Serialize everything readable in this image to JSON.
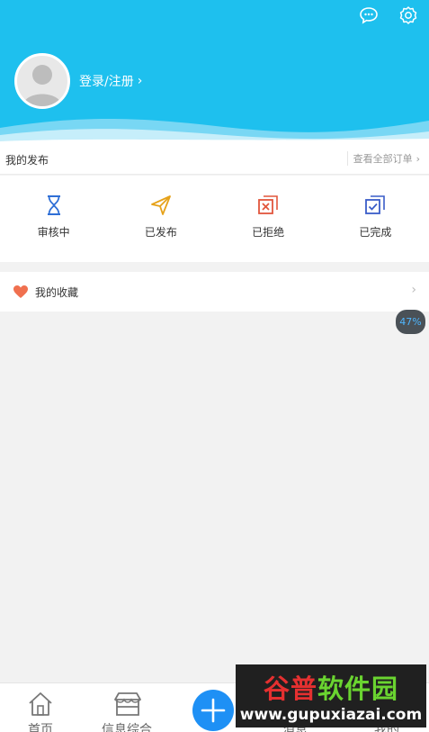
{
  "header": {
    "login_label": "登录/注册",
    "login_chevron": "›",
    "icons": [
      "message-icon",
      "gear-icon"
    ]
  },
  "publish": {
    "title": "我的发布",
    "view_all": "查看全部订单",
    "view_all_chevron": "›",
    "items": [
      {
        "label": "审核中",
        "icon": "hourglass-icon",
        "color": "#2f6fd6"
      },
      {
        "label": "已发布",
        "icon": "paper-plane-icon",
        "color": "#e6a21a"
      },
      {
        "label": "已拒绝",
        "icon": "rejected-icon",
        "color": "#e2563c"
      },
      {
        "label": "已完成",
        "icon": "completed-icon",
        "color": "#3a5dc8"
      }
    ]
  },
  "favorites": {
    "label": "我的收藏",
    "icon": "heart-icon",
    "arrow": "›"
  },
  "progress_badge": "47%",
  "tabbar": {
    "home": "首页",
    "info": "信息综合",
    "message": "消息",
    "mine": "我的"
  },
  "watermark": {
    "brand_a": "谷普",
    "brand_b": "软件园",
    "url": "www.gupuxiazai.com"
  },
  "colors": {
    "header_bg": "#1ec0ee",
    "plus_button": "#1e90f5",
    "background": "#f2f2f2"
  }
}
